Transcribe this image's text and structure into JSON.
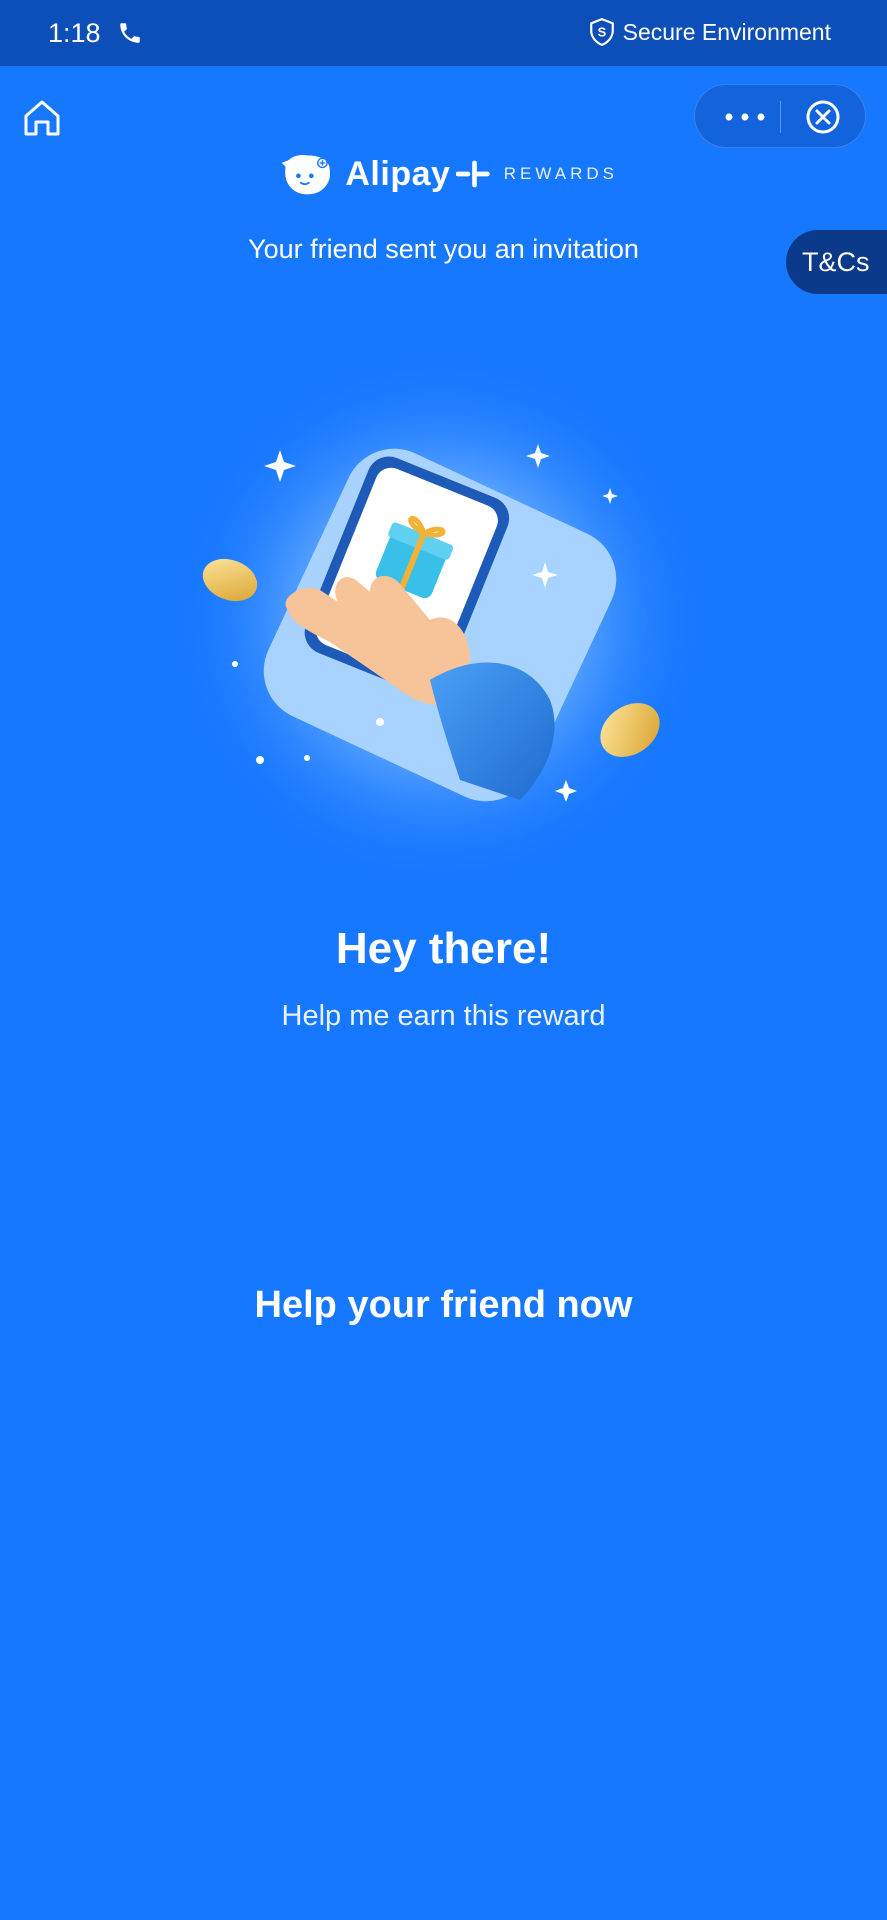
{
  "status_bar": {
    "time": "1:18",
    "secure_label": "Secure Environment",
    "icons": [
      "phone-icon",
      "shield-icon"
    ]
  },
  "nav": {
    "home_icon": "home-icon",
    "more_icon": "more-icon",
    "close_icon": "close-icon"
  },
  "brand": {
    "name": "Alipay",
    "suffix": "REWARDS",
    "plus_icon": "plus-icon"
  },
  "header": {
    "invite_text": "Your friend sent you an invitation",
    "tcs_label": "T&Cs"
  },
  "main": {
    "headline": "Hey there!",
    "subline": "Help me earn this reward",
    "cta_label": "Help your friend now"
  },
  "colors": {
    "background": "#1677ff",
    "status_bar": "#0d4fb8",
    "tcs_tab": "#0b3a8a"
  }
}
